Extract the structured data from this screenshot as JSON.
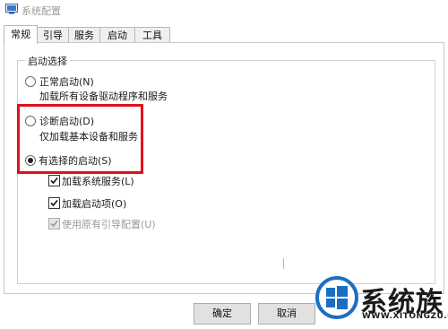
{
  "window": {
    "title": "系统配置"
  },
  "tabs": [
    "常规",
    "引导",
    "服务",
    "启动",
    "工具"
  ],
  "startup_group": {
    "label": "启动选择",
    "normal": {
      "label": "正常启动(N)",
      "desc": "加载所有设备驱动程序和服务",
      "checked": false
    },
    "diagnostic": {
      "label": "诊断启动(D)",
      "desc": "仅加载基本设备和服务",
      "checked": false
    },
    "selective": {
      "label": "有选择的启动(S)",
      "checked": true,
      "options": [
        {
          "label": "加载系统服务(L)",
          "checked": true,
          "enabled": true
        },
        {
          "label": "加载启动项(O)",
          "checked": true,
          "enabled": true
        },
        {
          "label": "使用原有引导配置(U)",
          "checked": true,
          "enabled": false
        }
      ]
    }
  },
  "buttons": {
    "ok": "确定",
    "cancel": "取消"
  },
  "watermark": {
    "name": "系统族",
    "url": "WWW.XITONGZU.COM"
  },
  "colors": {
    "highlight": "#e0101a",
    "watermark_blue": "#1b6fc2"
  }
}
